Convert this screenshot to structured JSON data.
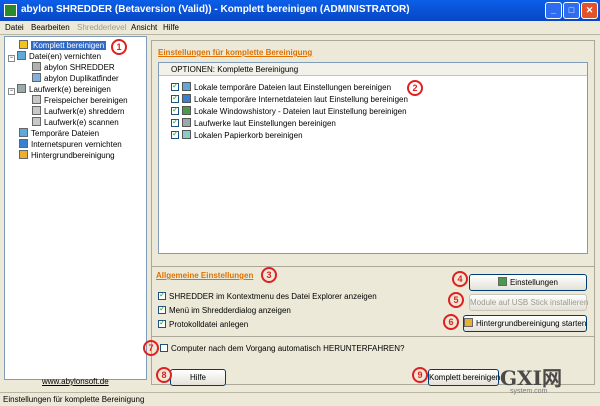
{
  "window": {
    "title": "abylon SHREDDER (Betaversion (Valid)) - Komplett bereinigen (ADMINISTRATOR)"
  },
  "menu": [
    "Datei",
    "Bearbeiten",
    "Shredderlevel",
    "Ansicht",
    "Hilfe"
  ],
  "tree": [
    {
      "label": "Komplett bereinigen",
      "selected": true
    },
    {
      "label": "Datei(en) vernichten"
    },
    {
      "label": "abylon SHREDDER"
    },
    {
      "label": "abylon Duplikatfinder"
    },
    {
      "label": "Laufwerk(e) bereinigen"
    },
    {
      "label": "Freispeicher bereinigen"
    },
    {
      "label": "Laufwerk(e) shreddern"
    },
    {
      "label": "Laufwerk(e) scannen"
    },
    {
      "label": "Temporäre Dateien"
    },
    {
      "label": "Internetspuren vernichten"
    },
    {
      "label": "Hintergrundbereinigung"
    }
  ],
  "weblink": "www.abylonsoft.de",
  "section1": {
    "title": "Einstellungen für komplette Bereinigung"
  },
  "options": {
    "header": "OPTIONEN: Komplette Bereinigung",
    "items": [
      "Lokale temporäre Dateien laut Einstellungen bereinigen",
      "Lokale temporäre Internetdateien laut Einstellung bereinigen",
      "Lokale Windowshistory - Dateien laut Einstellung bereinigen",
      "Laufwerke laut Einstellungen bereinigen",
      "Lokalen Papierkorb bereinigen"
    ]
  },
  "section2": {
    "title": "Allgemeine Einstellungen"
  },
  "general": {
    "items": [
      "SHREDDER im Kontextmenu des Datei Explorer anzeigen",
      "Menü im Shredderdialog anzeigen",
      "Protokolldatei anlegen"
    ]
  },
  "buttons": {
    "einstellungen": "Einstellungen",
    "usb": "Module auf USB Stick installieren",
    "hintergrund": "Hintergrundbereinigung starten",
    "hilfe": "Hilfe",
    "komplett": "Komplett bereinigen"
  },
  "shutdown_label": "Computer nach dem Vorgang automatisch HERUNTERFAHREN?",
  "status": "Einstellungen für komplette Bereinigung",
  "callouts": [
    "1",
    "2",
    "3",
    "4",
    "5",
    "6",
    "7",
    "8",
    "9"
  ],
  "watermark": {
    "logo": "GXI网",
    "url": "system.com"
  }
}
